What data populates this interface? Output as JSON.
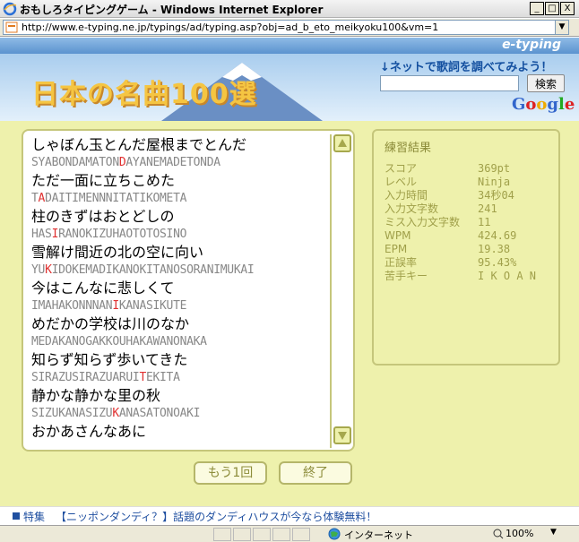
{
  "window": {
    "title": "おもしろタイピングゲーム - Windows Internet Explorer",
    "minimize": "_",
    "maximize": "□",
    "close": "X"
  },
  "address": {
    "url": "http://www.e-typing.ne.jp/typings/ad/typing.asp?obj=ad_b_eto_meikyoku100&vm=1"
  },
  "header": {
    "brand": "e-typing",
    "banner_title": "日本の名曲100選",
    "lyrics_link": "↓ネットで歌詞を調べてみよう！",
    "search_button": "検索",
    "google": [
      "G",
      "o",
      "o",
      "g",
      "l",
      "e"
    ],
    "google_colors": [
      "#3366cc",
      "#dd2222",
      "#eeaa00",
      "#3366cc",
      "#22aa22",
      "#dd2222"
    ]
  },
  "lyrics": [
    {
      "jp": "しゃぼん玉とんだ屋根までとんだ",
      "romaji_before": "SYABONDAMATON",
      "romaji_miss": "D",
      "romaji_after": "AYANEMADETONDA"
    },
    {
      "jp": "ただ一面に立ちこめた",
      "romaji_before": "T",
      "romaji_miss": "A",
      "romaji_after": "DAITIMENNNITATIKOMETA"
    },
    {
      "jp": "柱のきずはおとどしの",
      "romaji_before": "HAS",
      "romaji_miss": "I",
      "romaji_after": "RANOKIZUHAOTOTOSINO"
    },
    {
      "jp": "雪解け間近の北の空に向い",
      "romaji_before": "YU",
      "romaji_miss": "K",
      "romaji_after": "IDOKEMADIKANOKITANOSORANIMUKAI"
    },
    {
      "jp": "今はこんなに悲しくて",
      "romaji_before": "IMAHAKONNNAN",
      "romaji_miss": "I",
      "romaji_after": "KANASIKUTE"
    },
    {
      "jp": "めだかの学校は川のなか",
      "romaji_before": "MEDAKANOGAKKOUHAKAWANONAKA",
      "romaji_miss": "",
      "romaji_after": ""
    },
    {
      "jp": "知らず知らず歩いてきた",
      "romaji_before": "SIRAZUSIRAZUARUI",
      "romaji_miss": "T",
      "romaji_after": "EKITA"
    },
    {
      "jp": "静かな静かな里の秋",
      "romaji_before": "SIZUKANASIZU",
      "romaji_miss": "K",
      "romaji_after": "ANASATONOAKI"
    },
    {
      "jp": "おかあさんなあに",
      "romaji_before": "",
      "romaji_miss": "",
      "romaji_after": ""
    }
  ],
  "results": {
    "title": "練習結果",
    "rows": [
      {
        "label": "スコア",
        "value": "369pt"
      },
      {
        "label": "レベル",
        "value": "Ninja"
      },
      {
        "label": "入力時間",
        "value": "34秒04"
      },
      {
        "label": "入力文字数",
        "value": "241"
      },
      {
        "label": "ミス入力文字数",
        "value": "11"
      },
      {
        "label": "WPM",
        "value": "424.69"
      },
      {
        "label": "EPM",
        "value": "19.38"
      },
      {
        "label": "正誤率",
        "value": "95.43%"
      },
      {
        "label": "苦手キー",
        "value": "I K O A N"
      }
    ]
  },
  "buttons": {
    "retry": "もう1回",
    "finish": "終了"
  },
  "ad": {
    "label": "特集",
    "text": "【ニッポンダンディ？】話題のダンディハウスが今なら体験無料！"
  },
  "status": {
    "zone": "インターネット",
    "zoom": "100%"
  }
}
